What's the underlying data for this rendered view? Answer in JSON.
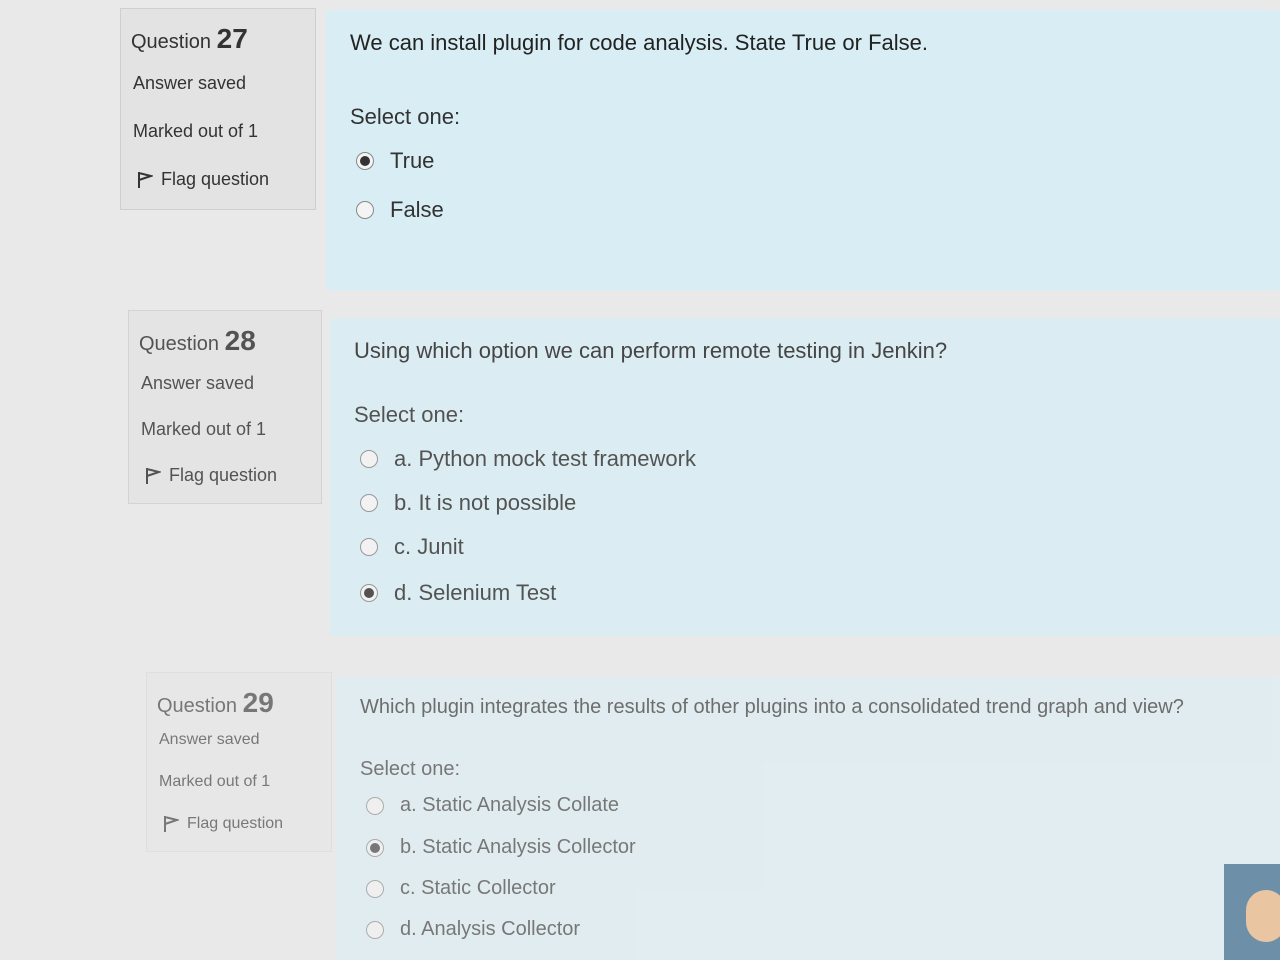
{
  "questions": [
    {
      "number_label": "Question",
      "number": "27",
      "state": "Answer saved",
      "grade": "Marked out of 1",
      "flag": "Flag question",
      "text": "We can install plugin for code analysis. State True or False.",
      "prompt": "Select one:",
      "options": [
        {
          "label": "True",
          "checked": true
        },
        {
          "label": "False",
          "checked": false
        }
      ]
    },
    {
      "number_label": "Question",
      "number": "28",
      "state": "Answer saved",
      "grade": "Marked out of 1",
      "flag": "Flag question",
      "text": "Using which option we can perform remote testing in Jenkin?",
      "prompt": "Select one:",
      "options": [
        {
          "label": "a. Python mock test framework",
          "checked": false
        },
        {
          "label": "b. It is not possible",
          "checked": false
        },
        {
          "label": "c. Junit",
          "checked": false
        },
        {
          "label": "d. Selenium Test",
          "checked": true
        }
      ]
    },
    {
      "number_label": "Question",
      "number": "29",
      "state": "Answer saved",
      "grade": "Marked out of 1",
      "flag": "Flag question",
      "text": "Which plugin integrates the results of other plugins into a consolidated trend graph and view?",
      "prompt": "Select one:",
      "options": [
        {
          "label": "a. Static Analysis Collate",
          "checked": false
        },
        {
          "label": "b. Static Analysis Collector",
          "checked": true
        },
        {
          "label": "c. Static Collector",
          "checked": false
        },
        {
          "label": "d. Analysis Collector",
          "checked": false
        }
      ]
    }
  ]
}
